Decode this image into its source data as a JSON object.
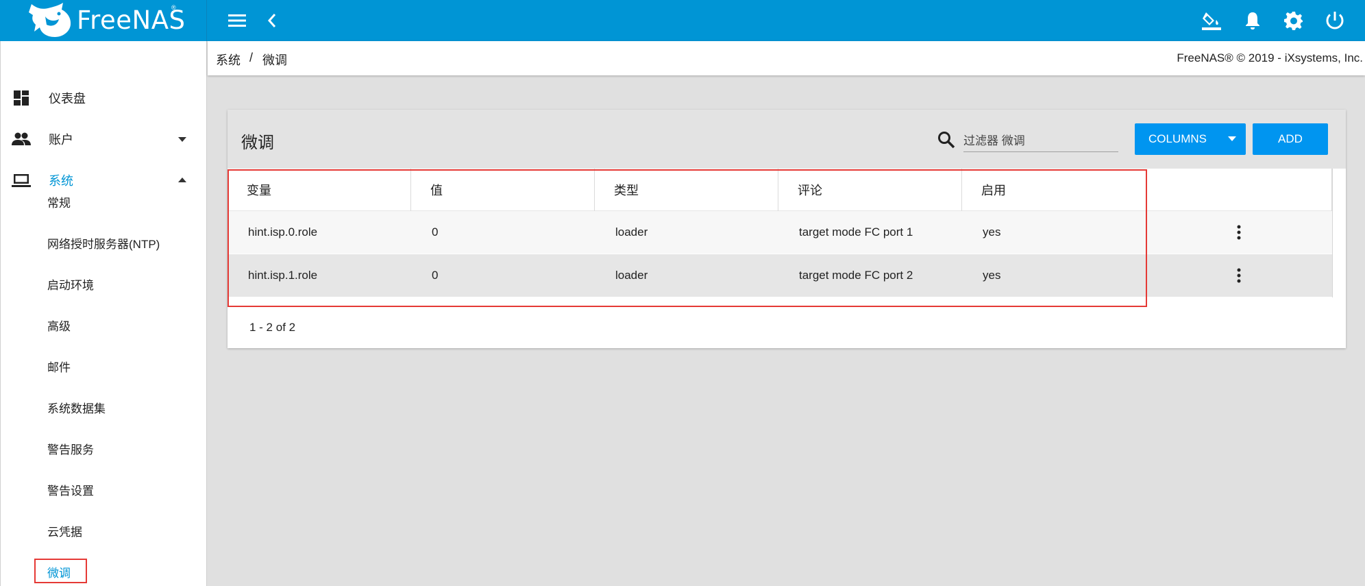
{
  "brand": {
    "name": "FreeNAS",
    "tm": "®"
  },
  "topbar": {
    "icons": [
      "menu-icon",
      "back-chevron-icon",
      "theme-paint-icon",
      "bell-icon",
      "gear-icon",
      "power-icon"
    ]
  },
  "sidebar": {
    "items": [
      {
        "label": "仪表盘",
        "icon": "dashboard-icon"
      },
      {
        "label": "账户",
        "icon": "people-icon",
        "expand": "down"
      },
      {
        "label": "系统",
        "icon": "laptop-icon",
        "expand": "up",
        "active": true
      }
    ],
    "sub_items": [
      {
        "label": "常规"
      },
      {
        "label": "网络授时服务器(NTP)"
      },
      {
        "label": "启动环境"
      },
      {
        "label": "高级"
      },
      {
        "label": "邮件"
      },
      {
        "label": "系统数据集"
      },
      {
        "label": "警告服务"
      },
      {
        "label": "警告设置"
      },
      {
        "label": "云凭据"
      },
      {
        "label": "微调",
        "active": true
      }
    ]
  },
  "breadcrumb": {
    "parent": "系统",
    "separator": "/",
    "current": "微调"
  },
  "copyright": "FreeNAS® © 2019 - iXsystems, Inc.",
  "card": {
    "title": "微调",
    "filter_placeholder": "过滤器 微调",
    "columns_label": "COLUMNS",
    "add_label": "ADD"
  },
  "table": {
    "headers": [
      "变量",
      "值",
      "类型",
      "评论",
      "启用"
    ],
    "rows": [
      {
        "var": "hint.isp.0.role",
        "value": "0",
        "type": "loader",
        "comment": "target mode FC port 1",
        "enabled": "yes"
      },
      {
        "var": "hint.isp.1.role",
        "value": "0",
        "type": "loader",
        "comment": "target mode FC port 2",
        "enabled": "yes"
      }
    ],
    "pager": "1 - 2 of 2"
  },
  "colors": {
    "accent": "#0095d5",
    "button": "#0095f0",
    "highlight_box": "#e53935"
  }
}
